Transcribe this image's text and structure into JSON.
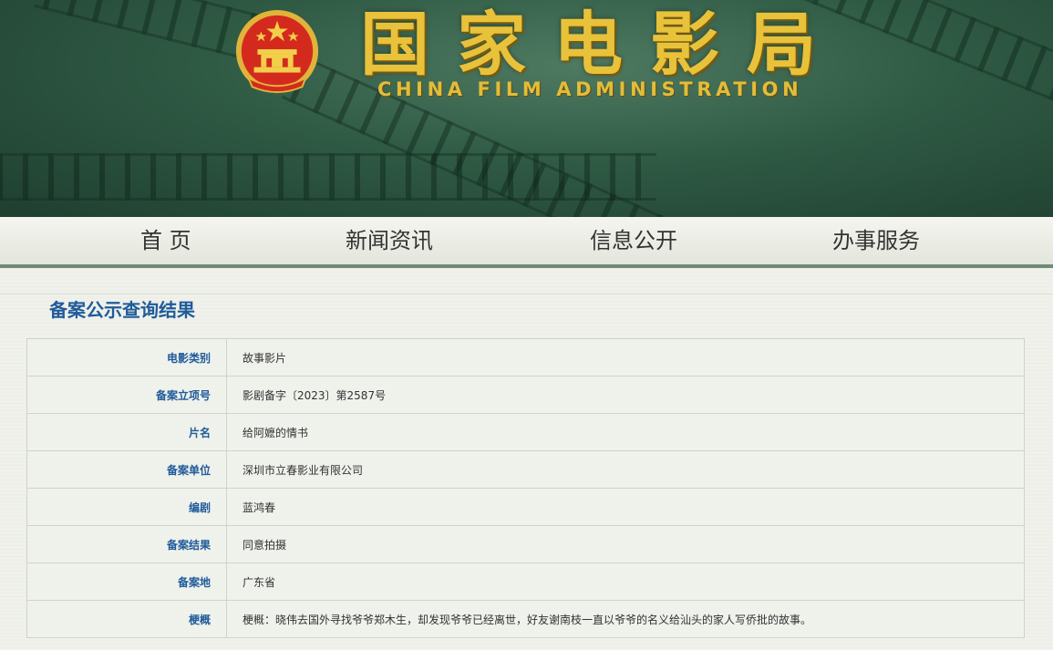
{
  "header": {
    "title_chars": [
      "国",
      "家",
      "电",
      "影",
      "局"
    ],
    "subtitle": "CHINA FILM ADMINISTRATION",
    "emblem": "national-emblem"
  },
  "nav": {
    "items": [
      {
        "label": "首 页"
      },
      {
        "label": "新闻资讯"
      },
      {
        "label": "信息公开"
      },
      {
        "label": "办事服务"
      }
    ]
  },
  "main": {
    "page_title": "备案公示查询结果",
    "rows": [
      {
        "label": "电影类别",
        "value": "故事影片"
      },
      {
        "label": "备案立项号",
        "value": "影剧备字〔2023〕第2587号"
      },
      {
        "label": "片名",
        "value": "给阿嬷的情书"
      },
      {
        "label": "备案单位",
        "value": "深圳市立春影业有限公司"
      },
      {
        "label": "编剧",
        "value": "蓝鸿春"
      },
      {
        "label": "备案结果",
        "value": "同意拍摄"
      },
      {
        "label": "备案地",
        "value": "广东省"
      },
      {
        "label": "梗概",
        "value": "梗概：晓伟去国外寻找爷爷郑木生，却发现爷爷已经离世，好友谢南枝一直以爷爷的名义给汕头的家人写侨批的故事。"
      }
    ]
  },
  "colors": {
    "banner_green": "#2f5a44",
    "gold": "#e8c23a",
    "label_blue": "#1f5b9a",
    "nav_border": "#6f8b78"
  }
}
